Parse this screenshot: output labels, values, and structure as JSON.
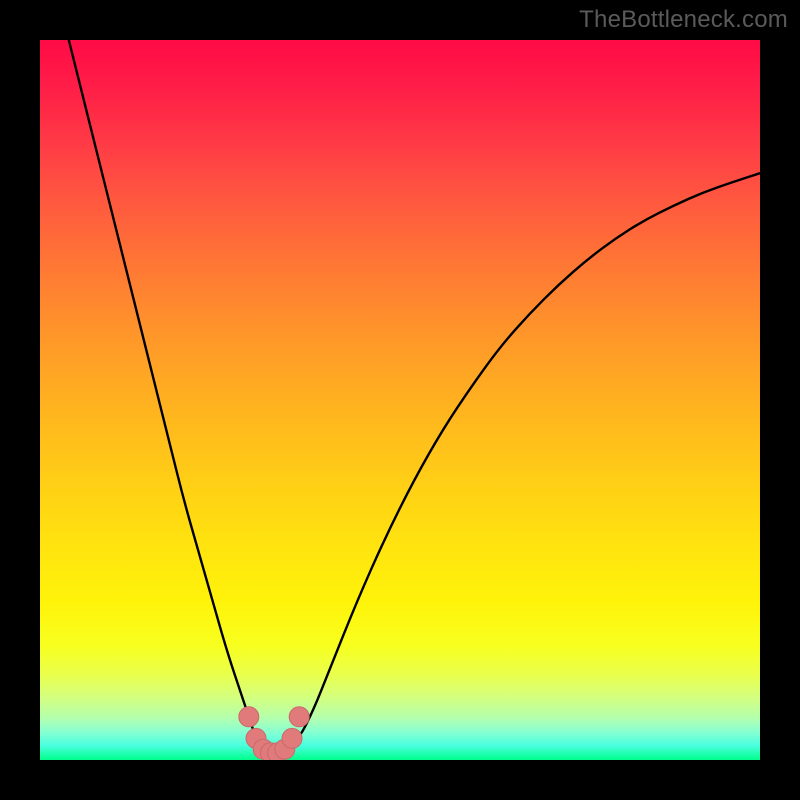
{
  "watermark": "TheBottleneck.com",
  "colors": {
    "curve_stroke": "#000000",
    "marker_fill": "#e17b7b",
    "marker_stroke": "#c96a6a"
  },
  "chart_data": {
    "type": "line",
    "title": "",
    "xlabel": "",
    "ylabel": "",
    "xlim": [
      0,
      100
    ],
    "ylim": [
      0,
      100
    ],
    "grid": false,
    "legend": false,
    "series": [
      {
        "name": "bottleneck-curve",
        "x": [
          4,
          6,
          8,
          10,
          12,
          14,
          16,
          18,
          20,
          22,
          24,
          26,
          28,
          29,
          30,
          31,
          32,
          33,
          34,
          36,
          38,
          40,
          44,
          48,
          52,
          56,
          60,
          64,
          68,
          72,
          76,
          80,
          84,
          88,
          92,
          96,
          100
        ],
        "y": [
          100,
          92,
          84,
          76,
          68,
          60,
          52,
          44,
          36,
          29,
          22,
          15,
          9,
          6,
          3,
          1.5,
          1,
          1,
          1.5,
          3,
          7,
          12,
          22,
          31,
          39,
          46,
          52,
          57.5,
          62,
          66,
          69.5,
          72.5,
          75,
          77,
          78.8,
          80.2,
          81.5
        ]
      }
    ],
    "markers": [
      {
        "x": 29.0,
        "y": 6.0
      },
      {
        "x": 30.0,
        "y": 3.0
      },
      {
        "x": 31.0,
        "y": 1.5
      },
      {
        "x": 32.0,
        "y": 1.0
      },
      {
        "x": 33.0,
        "y": 1.0
      },
      {
        "x": 34.0,
        "y": 1.5
      },
      {
        "x": 35.0,
        "y": 3.0
      },
      {
        "x": 36.0,
        "y": 6.0
      }
    ]
  }
}
